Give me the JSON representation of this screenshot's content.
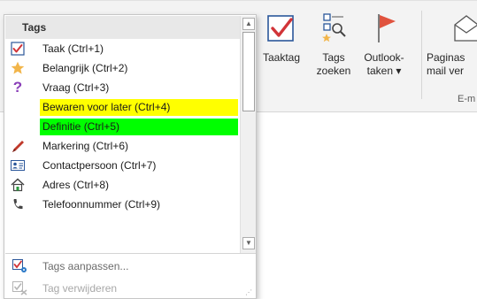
{
  "ribbon": {
    "buttons": [
      {
        "line1": "Taaktag",
        "line2": ""
      },
      {
        "line1": "Tags",
        "line2": "zoeken"
      },
      {
        "line1": "Outlook-",
        "line2": "taken ▾"
      },
      {
        "line1": "Paginas",
        "line2": "mail ver"
      }
    ],
    "group_label": "E-m"
  },
  "dropdown": {
    "header": "Tags",
    "items": [
      {
        "label": "Taak (Ctrl+1)",
        "icon": "checkbox-checked-icon",
        "highlight": ""
      },
      {
        "label": "Belangrijk (Ctrl+2)",
        "icon": "star-icon",
        "highlight": ""
      },
      {
        "label": "Vraag (Ctrl+3)",
        "icon": "question-mark-icon",
        "highlight": ""
      },
      {
        "label": "Bewaren voor later (Ctrl+4)",
        "icon": "none",
        "highlight": "#ffff00"
      },
      {
        "label": "Definitie (Ctrl+5)",
        "icon": "none",
        "highlight": "#00ff00"
      },
      {
        "label": "Markering (Ctrl+6)",
        "icon": "pen-icon",
        "highlight": ""
      },
      {
        "label": "Contactpersoon (Ctrl+7)",
        "icon": "contact-card-icon",
        "highlight": ""
      },
      {
        "label": "Adres (Ctrl+8)",
        "icon": "house-icon",
        "highlight": ""
      },
      {
        "label": "Telefoonnummer (Ctrl+9)",
        "icon": "phone-icon",
        "highlight": ""
      }
    ],
    "actions": [
      {
        "label": "Tags aanpassen...",
        "icon": "customize-tags-icon",
        "enabled": true
      },
      {
        "label": "Tag verwijderen",
        "icon": "remove-tag-icon",
        "enabled": false
      }
    ]
  },
  "colors": {
    "check_red": "#d13438",
    "flag_red": "#e0533e",
    "star_gold": "#f2b54a",
    "question_purple": "#8a3fb8"
  }
}
